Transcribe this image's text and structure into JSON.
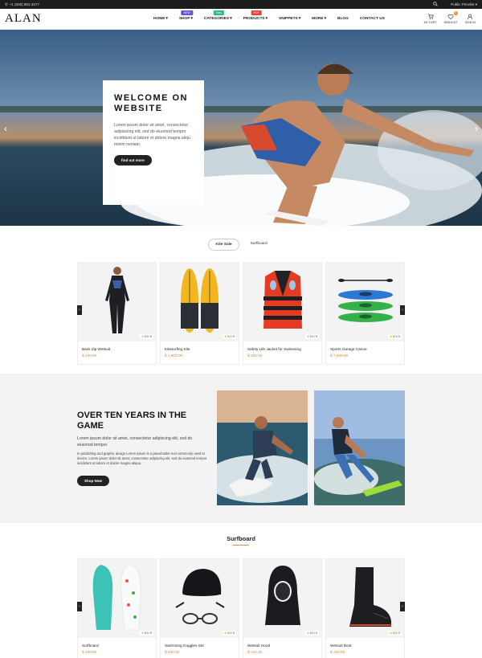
{
  "topbar": {
    "phone": "+1 (630) 891-3277",
    "language": "Public Pricelist"
  },
  "logo": "ALAN",
  "nav": [
    {
      "label": "HOME",
      "arrow": "▾",
      "badge": ""
    },
    {
      "label": "SHOP",
      "arrow": "▾",
      "badge": "NEW",
      "badge_color": "#6c4ed9"
    },
    {
      "label": "CATEGORIES",
      "arrow": "▾",
      "badge": "New",
      "badge_color": "#2db97a"
    },
    {
      "label": "PRODUCTS",
      "arrow": "▾",
      "badge": "HOT",
      "badge_color": "#e4413a"
    },
    {
      "label": "SNIPPETS",
      "arrow": "▾",
      "badge": ""
    },
    {
      "label": "MORE",
      "arrow": "▾",
      "badge": ""
    },
    {
      "label": "BLOG",
      "arrow": "",
      "badge": ""
    },
    {
      "label": "CONTACT US",
      "arrow": "",
      "badge": ""
    }
  ],
  "header_icons": {
    "cart": "MY CART",
    "wishlist": "WISHLIST",
    "wishlist_count": "0",
    "signin": "SIGN IN"
  },
  "hero": {
    "title": "WELCOME ON WEBSITE",
    "text": "Lorem ipsum dolor sit amet, consectetur adipisicing elit, sed do eiusmod tempor incididunt ut labore et dolore magna aliqu minim veniam.",
    "button": "find out more"
  },
  "tabs": [
    "Kite Sale",
    "Surfboard"
  ],
  "products_1": [
    {
      "name": "Back Zip Wetsuit",
      "price": "$ 100.00",
      "rating": "0.0 / 5",
      "icon": "wetsuit-icon"
    },
    {
      "name": "Kitesurfing Kite",
      "price": "$ 1,800.00",
      "rating": "0.0 / 5",
      "icon": "surfboard-icon"
    },
    {
      "name": "Safety Life Jacket for Swimming",
      "price": "$ 150.00",
      "rating": "0.0 / 5",
      "icon": "life-jacket-icon"
    },
    {
      "name": "Sports Garage Canoe",
      "price": "$ 7,000.00",
      "rating": "0.0 / 5",
      "icon": "kayak-icon"
    }
  ],
  "about": {
    "title": "OVER TEN YEARS IN THE GAME",
    "text1": "Lorem ipsum dolor sit amet, consectetur adipiscing elit, sed do eiusmod tempor.",
    "text2": "In publishing and graphic design Lorem ipsum is a placeholder text commonly used to device. Lorem ipsum dolor sit amet, consectetur adipiscing elit, sed do eiusmod tempor incididunt ut labore et dolore magna aliqua.",
    "button": "Shop Now"
  },
  "section2_title": "Surfboard",
  "products_2": [
    {
      "name": "Surfboard",
      "price": "$ 330.00",
      "rating": "0.0 / 5",
      "icon": "surfboard-pair-icon"
    },
    {
      "name": "Swimming Goggles Set",
      "price": "$ 100.00",
      "rating": "0.0 / 5",
      "icon": "swim-cap-goggles-icon"
    },
    {
      "name": "Wetsuit Hood",
      "price": "$ 100.00",
      "rating": "0.0 / 5",
      "icon": "wetsuit-hood-icon"
    },
    {
      "name": "Wetsuit Boot",
      "price": "$ 150.00",
      "rating": "0.0 / 5",
      "icon": "wetsuit-boot-icon"
    }
  ],
  "colors": {
    "accent": "#e2893a",
    "dark": "#222222",
    "topbar": "#1c1c1c"
  }
}
